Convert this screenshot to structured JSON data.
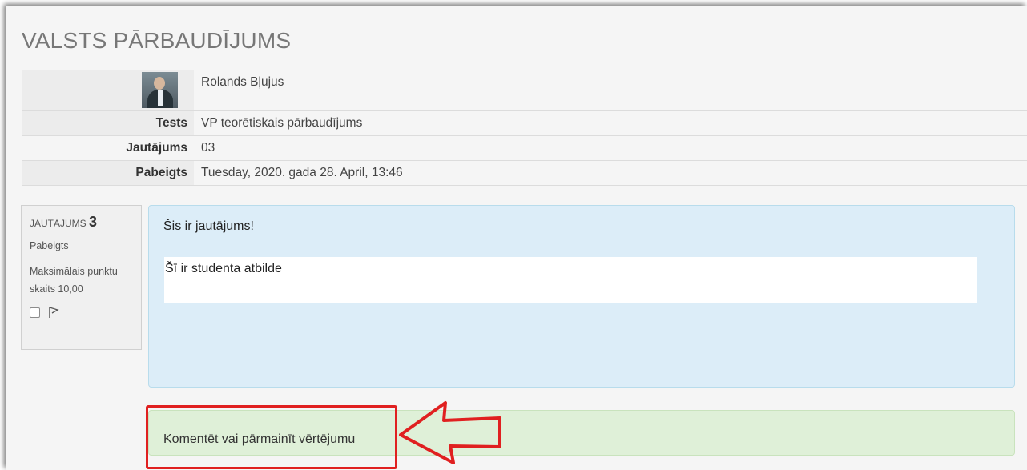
{
  "page": {
    "title": "VALSTS PĀRBAUDĪJUMS"
  },
  "summary": {
    "user_name": "Rolands Bļujus",
    "rows": [
      {
        "label": "Tests",
        "value": "VP teorētiskais pārbaudījums"
      },
      {
        "label": "Jautājums",
        "value": "03"
      },
      {
        "label": "Pabeigts",
        "value": "Tuesday, 2020. gada 28. April, 13:46"
      }
    ]
  },
  "question_info": {
    "number_prefix": "JAUTĀJUMS",
    "number": "3",
    "state": "Pabeigts",
    "grade": "Maksimālais punktu skaits 10,00",
    "flag_icon": "flag-icon"
  },
  "question": {
    "text": "Šis ir jautājums!",
    "answer": "Šī ir studenta atbilde"
  },
  "comment": {
    "link": "Komentēt vai pārmainīt vērtējumu"
  },
  "colors": {
    "question_bg": "#dcedf8",
    "comment_bg": "#dff0d8",
    "highlight": "#e02020"
  }
}
